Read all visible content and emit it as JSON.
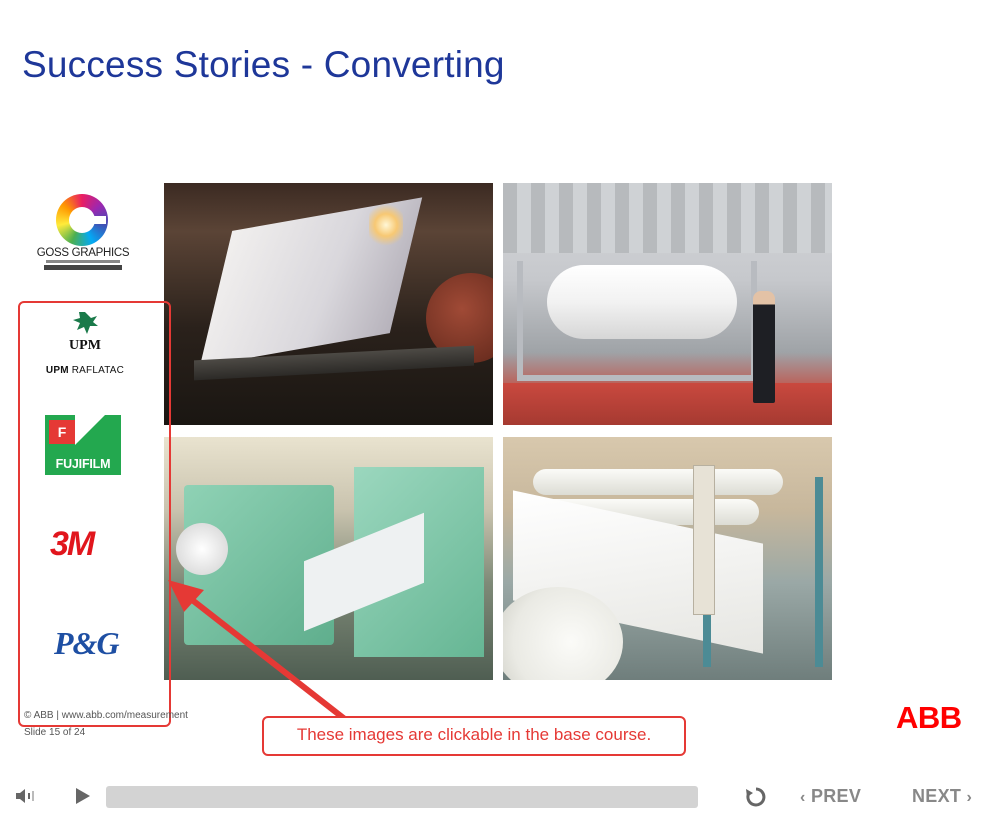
{
  "slide": {
    "title": "Success Stories - Converting",
    "copyright": "© ABB | www.abb.com/measurement",
    "slide_number": "Slide 15 of 24",
    "callout": "These images are clickable in the base course.",
    "brand": "ABB"
  },
  "logos": [
    {
      "name": "GOSS GRAPHICS",
      "icon": "goss-graphics-logo"
    },
    {
      "name": "UPM",
      "subtitle_bold": "UPM",
      "subtitle_rest": " RAFLATAC",
      "icon": "upm-logo"
    },
    {
      "name": "FUJIFILM",
      "icon": "fujifilm-logo"
    },
    {
      "name": "3M",
      "icon": "3m-logo"
    },
    {
      "name": "P&G",
      "icon": "pg-logo"
    }
  ],
  "colors": {
    "title": "#1e3799",
    "highlight": "#e53935",
    "brand": "#ff0000",
    "player_text": "#888888"
  },
  "player": {
    "prev_label": "PREV",
    "next_label": "NEXT",
    "progress": 0
  }
}
